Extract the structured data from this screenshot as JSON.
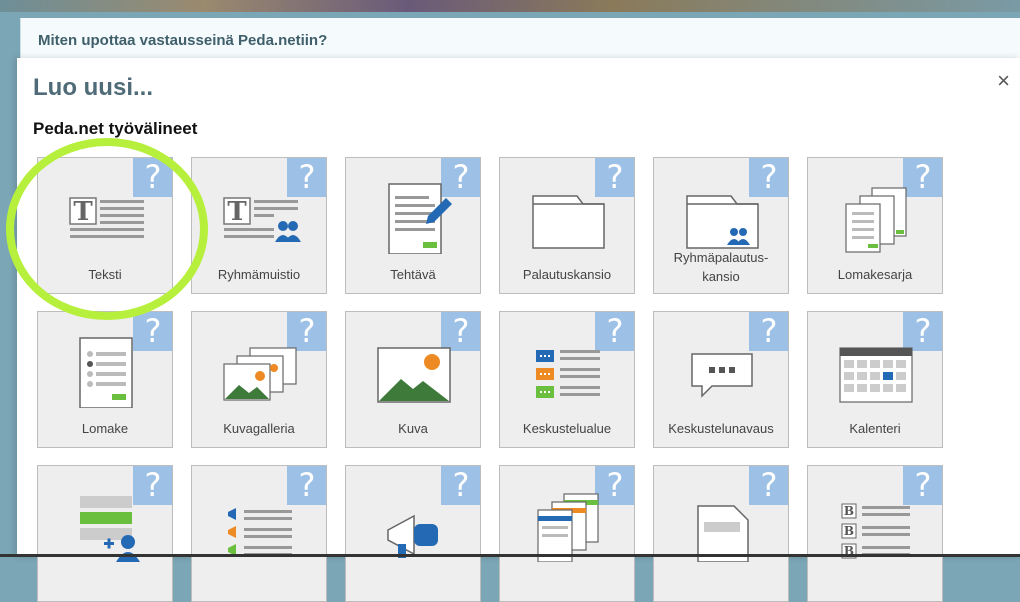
{
  "background_card": {
    "title": "Miten upottaa vastausseinä Peda.netiin?"
  },
  "modal": {
    "title": "Luo uusi...",
    "close_label": "×"
  },
  "section": {
    "title": "Peda.net työvälineet"
  },
  "help_label": "?",
  "tiles": [
    {
      "label": "Teksti",
      "icon": "text-icon"
    },
    {
      "label": "Ryhmämuistio",
      "icon": "group-note-icon"
    },
    {
      "label": "Tehtävä",
      "icon": "task-icon"
    },
    {
      "label": "Palautuskansio",
      "icon": "folder-icon"
    },
    {
      "label": "Ryhmäpalautus-kansio",
      "icon": "group-folder-icon"
    },
    {
      "label": "Lomakesarja",
      "icon": "form-series-icon"
    },
    {
      "label": "Lomake",
      "icon": "form-icon"
    },
    {
      "label": "Kuvagalleria",
      "icon": "gallery-icon"
    },
    {
      "label": "Kuva",
      "icon": "image-icon"
    },
    {
      "label": "Keskustelualue",
      "icon": "forum-icon"
    },
    {
      "label": "Keskustelunavaus",
      "icon": "discussion-icon"
    },
    {
      "label": "Kalenteri",
      "icon": "calendar-icon"
    },
    {
      "label": "",
      "icon": "list-add-user-icon"
    },
    {
      "label": "",
      "icon": "announcement-list-icon"
    },
    {
      "label": "",
      "icon": "megaphone-icon"
    },
    {
      "label": "",
      "icon": "documents-icon"
    },
    {
      "label": "",
      "icon": "document-icon"
    },
    {
      "label": "",
      "icon": "bold-list-icon"
    }
  ],
  "colors": {
    "help_badge": "#9cc0e6",
    "highlight": "#b6f03c",
    "title": "#4e6b77"
  }
}
